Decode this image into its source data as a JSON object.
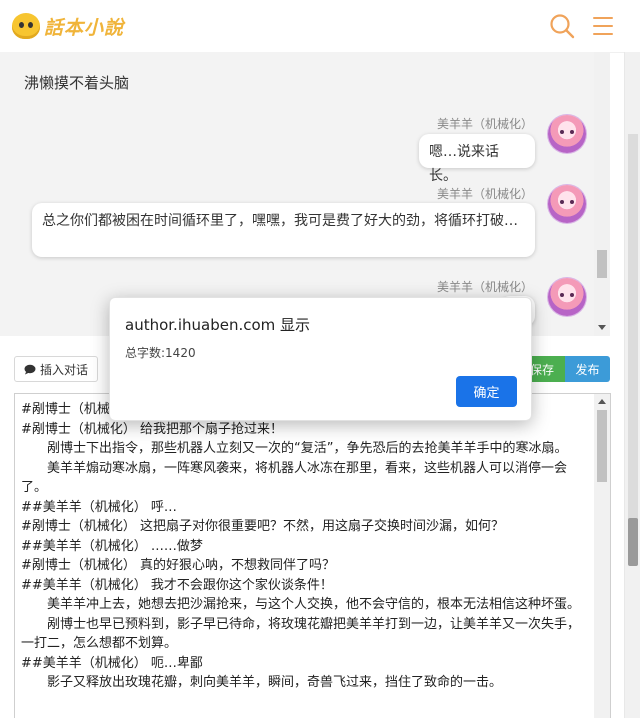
{
  "header": {
    "logo_text": "話本小說",
    "search_icon": "search-icon",
    "menu_icon": "hamburger-menu-icon",
    "accent_color": "#f0a35a"
  },
  "chat": {
    "top_text": "沸懒摸不着头脑",
    "messages": [
      {
        "name": "美羊羊（机械化）",
        "text": "嗯…说来话长。"
      },
      {
        "name": "美羊羊（机械化）",
        "text": "总之你们都被困在时间循环里了，嘿嘿，我可是费了好大的劲，将循环打破…"
      },
      {
        "name": "美羊羊（机械化）",
        "text": ""
      }
    ]
  },
  "toolbar": {
    "insert_label": "插入对话",
    "save_label": "保存",
    "publish_label": "发布"
  },
  "editor": {
    "lines": [
      {
        "text": "#剐博士（机械化）",
        "indent": false
      },
      {
        "text": "#剐博士（机械化） 给我把那个扇子抢过来！",
        "indent": false
      },
      {
        "text": "剐博士下出指令，那些机器人立刻又一次的“复活”，争先恐后的去抢美羊羊手中的寒冰扇。",
        "indent": true
      },
      {
        "text": "美羊羊煽动寒冰扇，一阵寒风袭来，将机器人冰冻在那里，看来，这些机器人可以消停一会了。",
        "indent": true
      },
      {
        "text": "##美羊羊（机械化） 呼…",
        "indent": false
      },
      {
        "text": "#剐博士（机械化） 这把扇子对你很重要吧？不然，用这扇子交换时间沙漏，如何？",
        "indent": false
      },
      {
        "text": "##美羊羊（机械化） ……做梦",
        "indent": false
      },
      {
        "text": "#剐博士（机械化） 真的好狠心呐，不想救同伴了吗？",
        "indent": false
      },
      {
        "text": "##美羊羊（机械化） 我才不会跟你这个家伙谈条件！",
        "indent": false
      },
      {
        "text": "美羊羊冲上去，她想去把沙漏抢来，与这个人交换，他不会守信的，根本无法相信这种坏蛋。",
        "indent": true
      },
      {
        "text": "剐博士也早已预料到，影子早已待命，将玫瑰花瓣把美羊羊打到一边，让美羊羊又一次失手，一打二，怎么想都不划算。",
        "indent": true
      },
      {
        "text": "##美羊羊（机械化） 呃…卑鄙",
        "indent": false
      },
      {
        "text": "影子又释放出玫瑰花瓣，刺向美羊羊，瞬间，奇兽飞过来，挡住了致命的一击。",
        "indent": true
      }
    ]
  },
  "dialog": {
    "title": "author.ihuaben.com 显示",
    "message": "总字数:1420",
    "ok_label": "确定"
  }
}
